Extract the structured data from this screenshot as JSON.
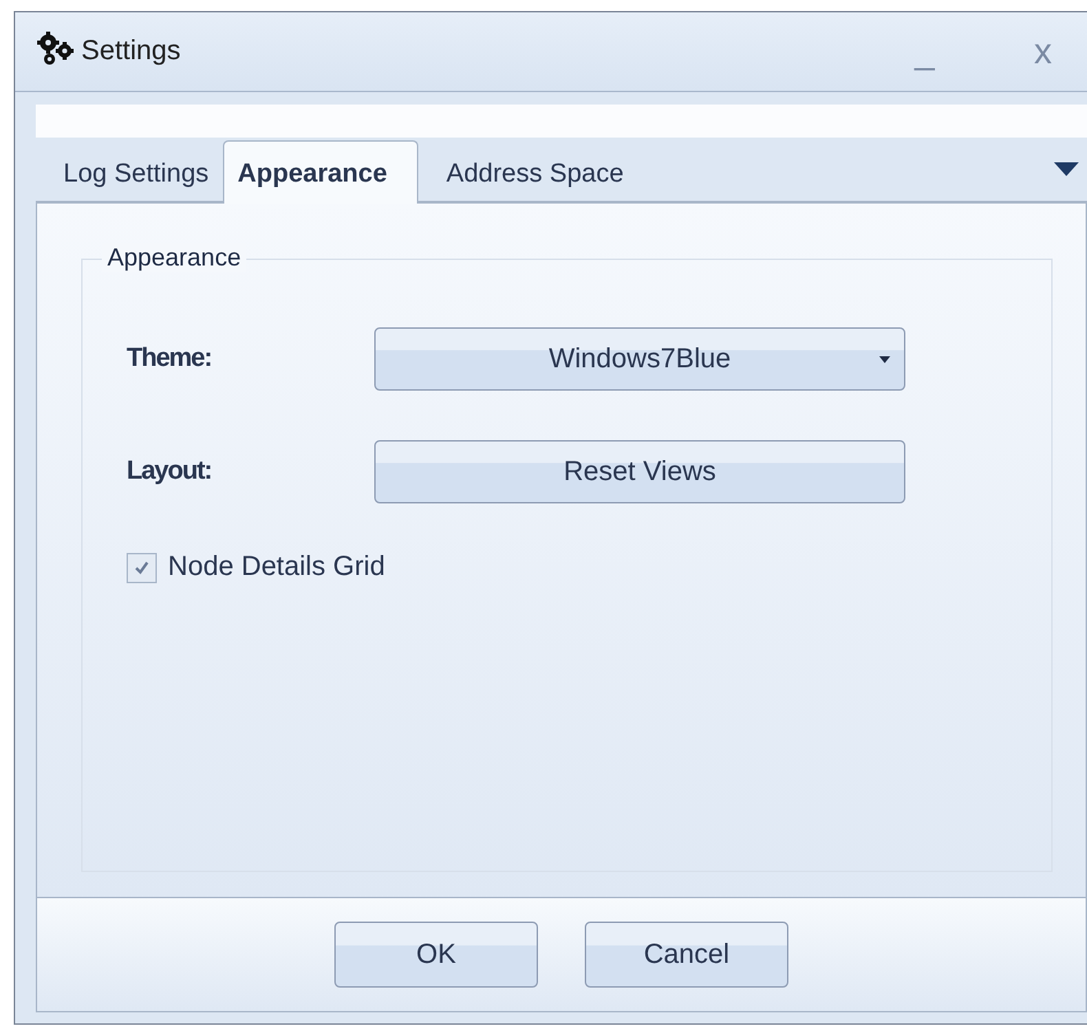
{
  "window": {
    "title": "Settings",
    "minimize": "_",
    "close": "x"
  },
  "tabs": [
    {
      "label": "Log Settings",
      "selected": false
    },
    {
      "label": "Appearance",
      "selected": true
    },
    {
      "label": "Address Space",
      "selected": false
    }
  ],
  "group": {
    "title": "Appearance",
    "rows": [
      {
        "kind": "dropdown",
        "label": "Theme:",
        "value": "Windows7Blue"
      },
      {
        "kind": "button",
        "label": "Layout:",
        "value": "Reset Views"
      }
    ],
    "checkbox": {
      "label": "Node Details Grid",
      "checked": true
    }
  },
  "buttons": [
    "OK",
    "Cancel"
  ]
}
